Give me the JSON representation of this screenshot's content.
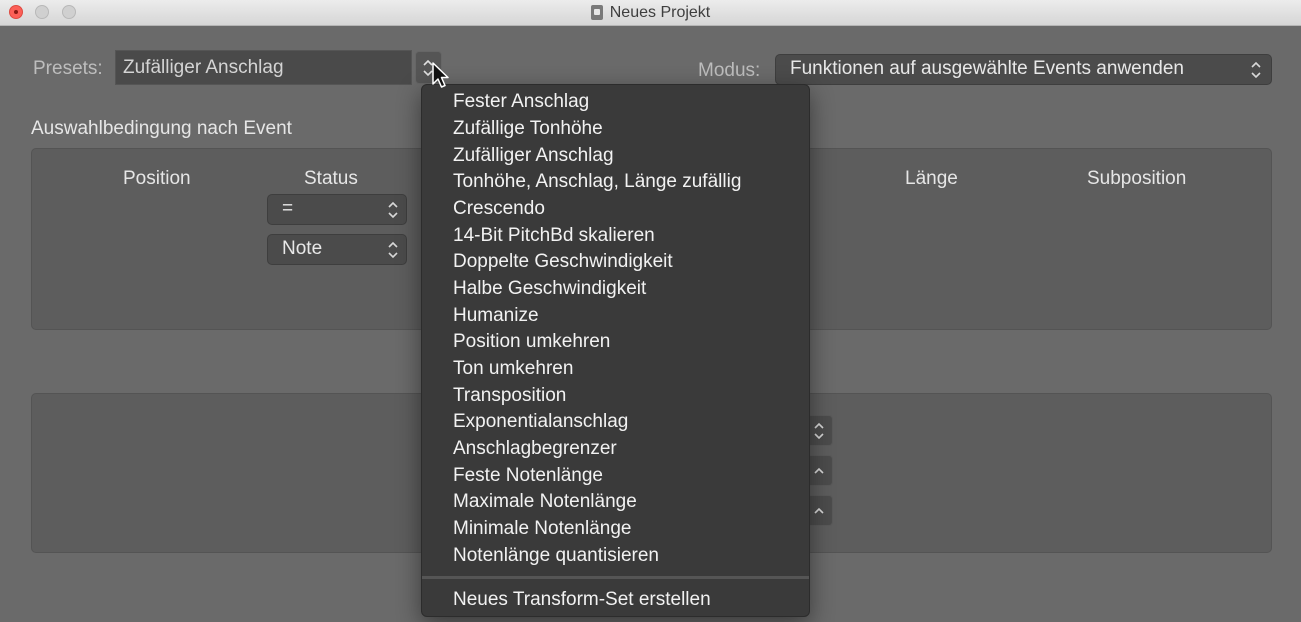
{
  "window": {
    "title": "Neues Projekt"
  },
  "presets": {
    "label": "Presets:",
    "value": "Zufälliger Anschlag"
  },
  "modus": {
    "label": "Modus:",
    "value": "Funktionen auf ausgewählte Events anwenden"
  },
  "selection": {
    "heading": "Auswahlbedingung nach Event",
    "columns": [
      "Position",
      "Status",
      "Länge",
      "Subposition"
    ],
    "status_operator": "=",
    "status_value": "Note"
  },
  "menu": {
    "items": [
      "Fester Anschlag",
      "Zufällige Tonhöhe",
      "Zufälliger Anschlag",
      "Tonhöhe, Anschlag, Länge zufällig",
      "Crescendo",
      "14-Bit PitchBd skalieren",
      "Doppelte Geschwindigkeit",
      "Halbe Geschwindigkeit",
      "Humanize",
      "Position umkehren",
      "Ton umkehren",
      "Transposition",
      "Exponentialanschlag",
      "Anschlagbegrenzer",
      "Feste Notenlänge",
      "Maximale Notenlänge",
      "Minimale Notenlänge",
      "Notenlänge quantisieren"
    ],
    "footer_item": "Neues Transform-Set erstellen"
  }
}
